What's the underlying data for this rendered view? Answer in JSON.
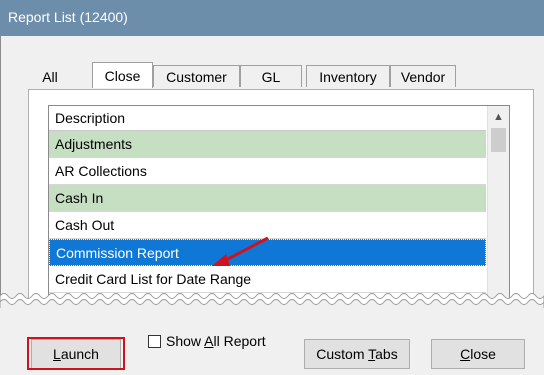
{
  "window": {
    "title": "Report List (12400)"
  },
  "tabs": [
    {
      "label": "All"
    },
    {
      "label": "Close"
    },
    {
      "label": "Customer"
    },
    {
      "label": "GL"
    },
    {
      "label": "Inventory"
    },
    {
      "label": "Vendor"
    }
  ],
  "active_tab": "Close",
  "list": {
    "header": "Description",
    "rows": [
      {
        "label": "Adjustments",
        "style": "green"
      },
      {
        "label": "AR Collections",
        "style": "white"
      },
      {
        "label": "Cash In",
        "style": "green"
      },
      {
        "label": "Cash Out",
        "style": "white"
      },
      {
        "label": "Commission Report",
        "style": "selected"
      },
      {
        "label": "Credit Card List for Date Range",
        "style": "white"
      }
    ]
  },
  "buttons": {
    "launch": {
      "pre": "",
      "mnemonic": "L",
      "post": "aunch"
    },
    "custom_tabs": {
      "pre": "Custom ",
      "mnemonic": "T",
      "post": "abs"
    },
    "close": {
      "pre": "",
      "mnemonic": "C",
      "post": "lose"
    }
  },
  "show_all": {
    "pre": "Show ",
    "mnemonic": "A",
    "post": "ll Report",
    "checked": false
  },
  "colors": {
    "titlebar": "#6d8eab",
    "row_green": "#c6dfc3",
    "row_selected": "#0f78d7",
    "annotation_red": "#d0121c"
  }
}
